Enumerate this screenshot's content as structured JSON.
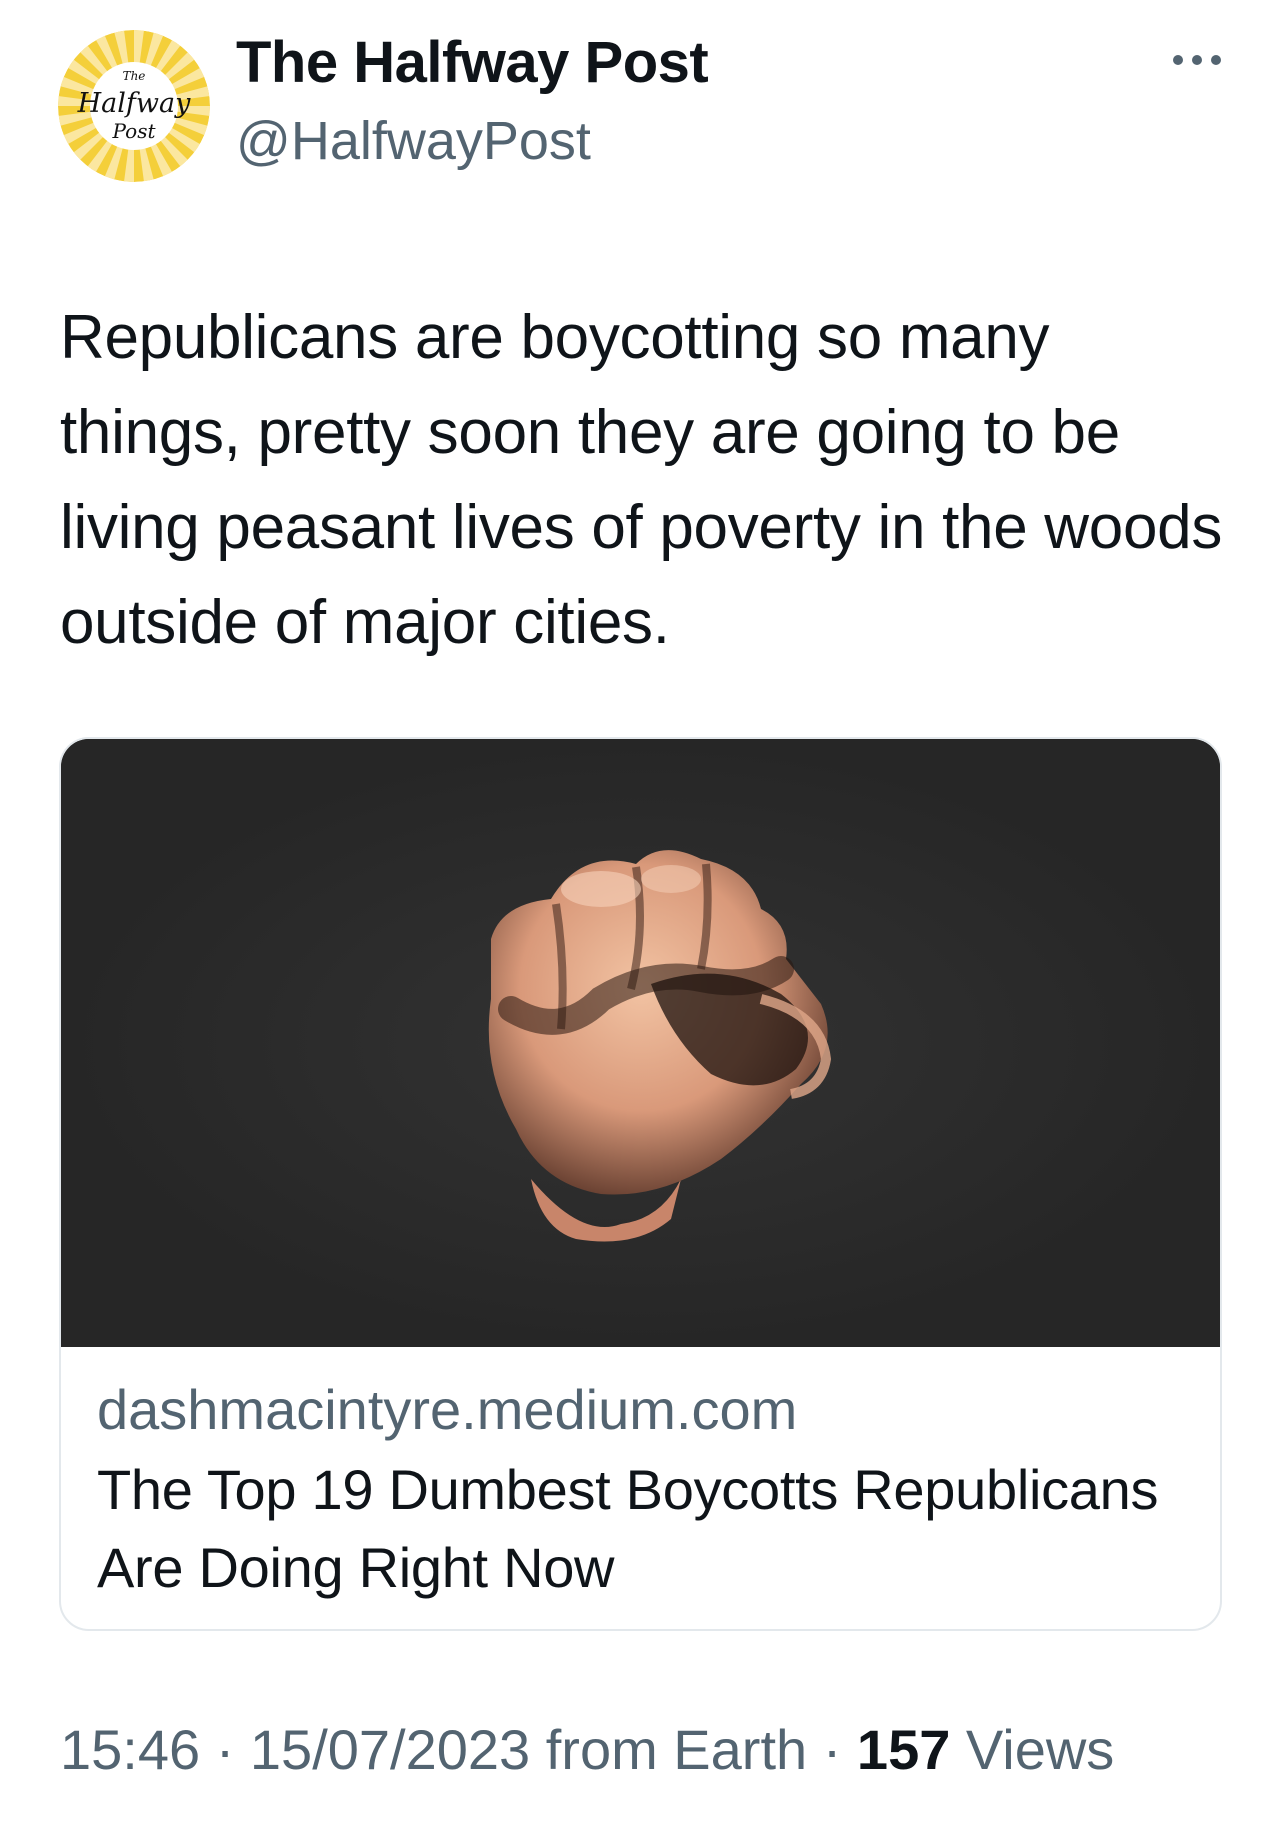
{
  "author": {
    "avatar_logo_text": [
      "The",
      "Halfway",
      "Post"
    ],
    "name": "The Halfway Post",
    "handle": "@HalfwayPost",
    "more_icon": "more-horizontal-icon"
  },
  "tweet": {
    "text": "Republicans are boycotting so many things, pretty soon they are going to be living peasant lives of poverty in the woods outside of major cities."
  },
  "link_card": {
    "image": "raised-fist-photo",
    "domain": "dashmacintyre.medium.com",
    "title": "The Top 19 Dumbest Boycotts Republicans Are Doing Right Now"
  },
  "meta": {
    "time": "15:46",
    "separator": " · ",
    "date": "15/07/2023",
    "source": "from Earth",
    "views_count": "157",
    "views_label": "Views"
  },
  "colors": {
    "text_primary": "#0f1419",
    "text_secondary": "#536471",
    "card_border": "#e3e8ec",
    "card_image_bg": "#262626",
    "avatar_yellow": "#f4cf3a"
  }
}
